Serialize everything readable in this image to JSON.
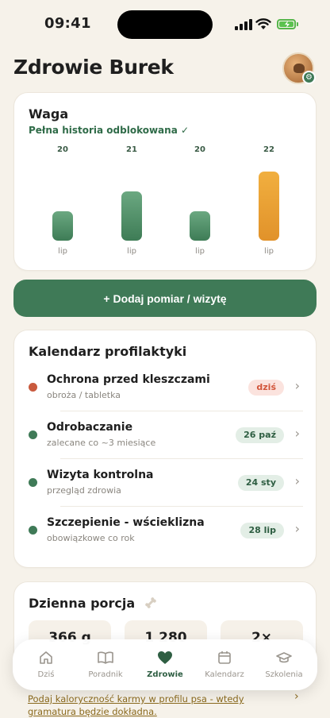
{
  "status_bar": {
    "time": "09:41"
  },
  "header": {
    "title": "Zdrowie Burek"
  },
  "weight": {
    "title": "Waga",
    "unlocked_text": "Pełna historia odblokowana ✓"
  },
  "chart_data": {
    "type": "bar",
    "categories": [
      "lip",
      "lip",
      "lip",
      "lip"
    ],
    "values": [
      20,
      21,
      20,
      22
    ],
    "title": "",
    "xlabel": "",
    "ylabel": "",
    "highlight_index": 3,
    "colors": {
      "default": "#4E8D66",
      "highlight": "#E9A035"
    }
  },
  "actions": {
    "add_label": "+ Dodaj pomiar / wizytę"
  },
  "calendar": {
    "title": "Kalendarz profilaktyki",
    "items": [
      {
        "name": "Ochrona przed kleszczami",
        "sub": "obroża / tabletka",
        "badge": "dziś",
        "status": "due",
        "dot_color": "#C95A3E"
      },
      {
        "name": "Odrobaczanie",
        "sub": "zalecane co ~3 miesiące",
        "badge": "26 paź",
        "status": "scheduled",
        "dot_color": "#3F7A57"
      },
      {
        "name": "Wizyta kontrolna",
        "sub": "przegląd zdrowia",
        "badge": "24 sty",
        "status": "scheduled",
        "dot_color": "#3F7A57"
      },
      {
        "name": "Szczepienie - wścieklizna",
        "sub": "obowiązkowe co rok",
        "badge": "28 lip",
        "status": "scheduled",
        "dot_color": "#3F7A57"
      }
    ]
  },
  "portion": {
    "title": "Dzienna porcja",
    "tiles": [
      "366 g",
      "1 280",
      "2×"
    ]
  },
  "tabs": [
    {
      "label": "Dziś",
      "icon": "home-icon"
    },
    {
      "label": "Poradnik",
      "icon": "book-icon"
    },
    {
      "label": "Zdrowie",
      "icon": "heart-icon",
      "active": true
    },
    {
      "label": "Kalendarz",
      "icon": "calendar-icon"
    },
    {
      "label": "Szkolenia",
      "icon": "graduation-cap-icon"
    }
  ],
  "hint": {
    "text": "Podaj kaloryczność karmy w profilu psa - wtedy gramatura będzie dokładna."
  },
  "colors": {
    "accent": "#3F7A57",
    "background": "#F6F2EA",
    "orange": "#E9A035",
    "danger": "#C95A3E"
  }
}
